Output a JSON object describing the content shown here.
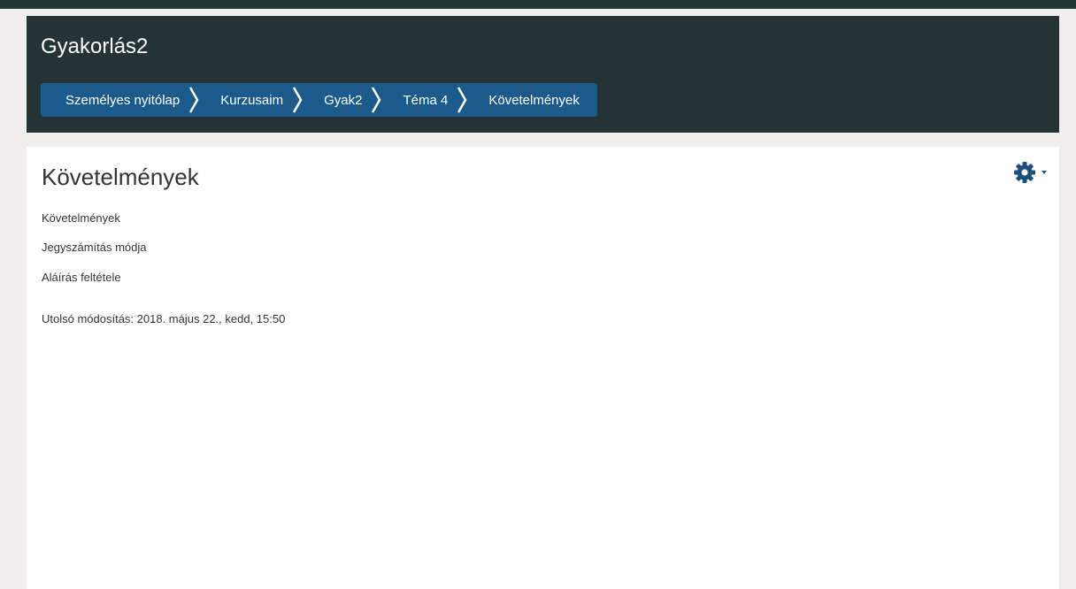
{
  "header": {
    "course_title": "Gyakorlás2"
  },
  "breadcrumb": {
    "items": [
      {
        "label": "Személyes nyitólap"
      },
      {
        "label": "Kurzusaim"
      },
      {
        "label": "Gyak2"
      },
      {
        "label": "Téma 4"
      },
      {
        "label": "Követelmények"
      }
    ]
  },
  "page": {
    "heading": "Követelmények",
    "lines": [
      "Követelmények",
      "Jegyszámítás módja",
      "Aláírás feltétele"
    ],
    "last_modified": "Utolsó módosítás: 2018. május 22., kedd, 15:50"
  },
  "settings": {
    "icon": "gear-icon"
  },
  "colors": {
    "header_bg": "#253335",
    "breadcrumb_bg": "#1b5a8b",
    "gear": "#1b4f7a"
  }
}
